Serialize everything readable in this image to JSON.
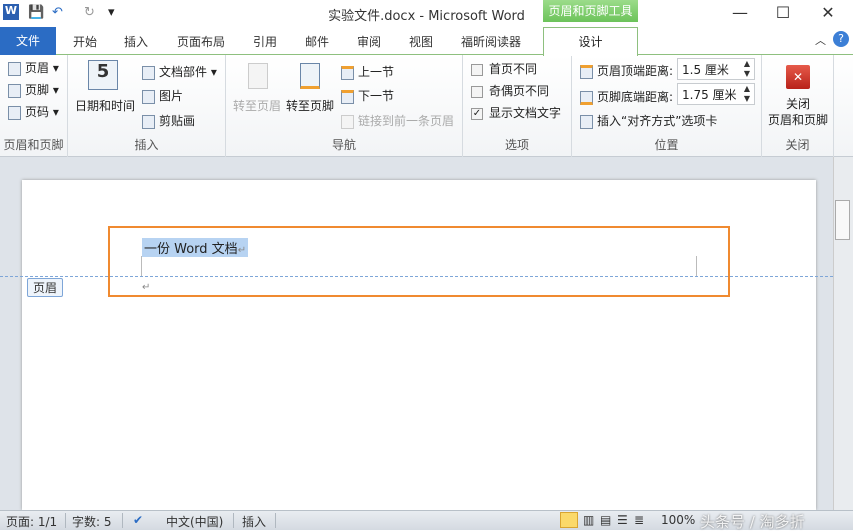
{
  "window": {
    "title": "实验文件.docx - Microsoft Word",
    "context_tab": "页眉和页脚工具",
    "minimize": "—",
    "maximize": "☐",
    "close": "✕"
  },
  "quick_access": {
    "word_icon": "W",
    "save": "💾",
    "undo": "↶",
    "redo": "↻",
    "customize": "▾"
  },
  "tabs": [
    "文件",
    "开始",
    "插入",
    "页面布局",
    "引用",
    "邮件",
    "审阅",
    "视图",
    "福昕阅读器",
    "设计"
  ],
  "ribbon": {
    "hf": {
      "label": "页眉和页脚",
      "items": [
        "页眉",
        "页脚",
        "页码"
      ]
    },
    "insert": {
      "label": "插入",
      "datetime": "日期和时间",
      "items": [
        "文档部件",
        "图片",
        "剪贴画"
      ]
    },
    "nav": {
      "label": "导航",
      "goto_header": "转至页眉",
      "goto_footer": "转至页脚",
      "prev": "上一节",
      "next": "下一节",
      "link": "链接到前一条页眉"
    },
    "options": {
      "label": "选项",
      "items": [
        {
          "label": "首页不同",
          "checked": false
        },
        {
          "label": "奇偶页不同",
          "checked": false
        },
        {
          "label": "显示文档文字",
          "checked": true
        }
      ]
    },
    "position": {
      "label": "位置",
      "header_dist_label": "页眉顶端距离:",
      "header_dist": "1.5 厘米",
      "footer_dist_label": "页脚底端距离:",
      "footer_dist": "1.75 厘米",
      "insert_tab": "插入“对齐方式”选项卡"
    },
    "close": {
      "label": "关闭",
      "button_line1": "关闭",
      "button_line2": "页眉和页脚"
    }
  },
  "document": {
    "header_text": "一份 Word 文档",
    "header_tag": "页眉",
    "para_mark": "↵"
  },
  "status": {
    "page": "页面: 1/1",
    "words": "字数: 5",
    "lang": "中文(中国)",
    "mode": "插入",
    "zoom": "100%",
    "watermark": "头条号 / 淘多折"
  },
  "colors": {
    "accent": "#2b6cc4",
    "context": "#6cc35a",
    "highlight": "#f08a30"
  }
}
